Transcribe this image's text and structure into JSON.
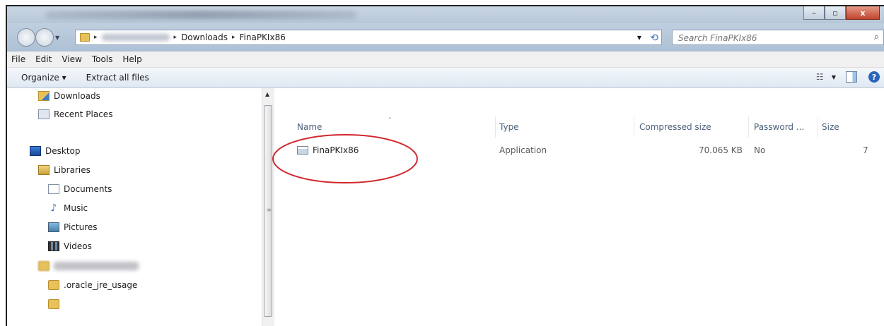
{
  "window": {
    "minimize_symbol": "–",
    "maximize_symbol": "▫",
    "close_symbol": "x"
  },
  "address": {
    "crumbs": [
      "Downloads",
      "FinaPKIx86"
    ],
    "separator": "▸",
    "search_placeholder": "Search FinaPKIx86"
  },
  "menubar": {
    "items": [
      "File",
      "Edit",
      "View",
      "Tools",
      "Help"
    ]
  },
  "toolbar": {
    "organize_label": "Organize ▾",
    "extract_label": "Extract all files"
  },
  "navpane": {
    "items": [
      {
        "label": "Downloads",
        "icon": "downloads-folder-icon"
      },
      {
        "label": "Recent Places",
        "icon": "recent-places-icon"
      },
      {
        "label": "Desktop",
        "icon": "desktop-icon"
      },
      {
        "label": "Libraries",
        "icon": "libraries-icon"
      },
      {
        "label": "Documents",
        "icon": "documents-icon"
      },
      {
        "label": "Music",
        "icon": "music-icon"
      },
      {
        "label": "Pictures",
        "icon": "pictures-icon"
      },
      {
        "label": "Videos",
        "icon": "videos-icon"
      },
      {
        "label": ".oracle_jre_usage",
        "icon": "folder-icon"
      }
    ]
  },
  "columns": [
    "Name",
    "Type",
    "Compressed size",
    "Password ...",
    "Size"
  ],
  "rows": [
    {
      "name": "FinaPKIx86",
      "type": "Application",
      "compressed_size": "70.065 KB",
      "password": "No",
      "size": "7"
    }
  ],
  "annotation": {
    "color": "#d0282e",
    "shape": "ellipse"
  }
}
